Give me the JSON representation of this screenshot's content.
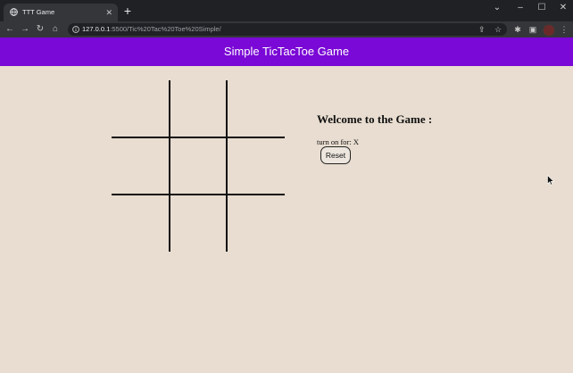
{
  "browser": {
    "tab_title": "TTT Game",
    "new_tab_label": "+",
    "url_host": "127.0.0.1",
    "url_rest": ":5500/Tic%20Tac%20Toe%20Simple/",
    "window_controls": [
      "⌄",
      "–",
      "☐",
      "✕"
    ]
  },
  "page": {
    "header_title": "Simple TicTacToe Game",
    "welcome": "Welcome to the Game :",
    "turn_text": "turn on for: X",
    "reset_label": "Reset"
  },
  "colors": {
    "header_bg": "#7a08d6",
    "page_bg": "#e8ddd0",
    "grid_line": "#111111"
  },
  "icons": [
    "globe-icon",
    "close-icon",
    "back-icon",
    "forward-icon",
    "reload-icon",
    "home-icon",
    "info-icon",
    "share-icon",
    "star-icon",
    "extensions-icon",
    "sidepanel-icon",
    "menu-icon"
  ]
}
